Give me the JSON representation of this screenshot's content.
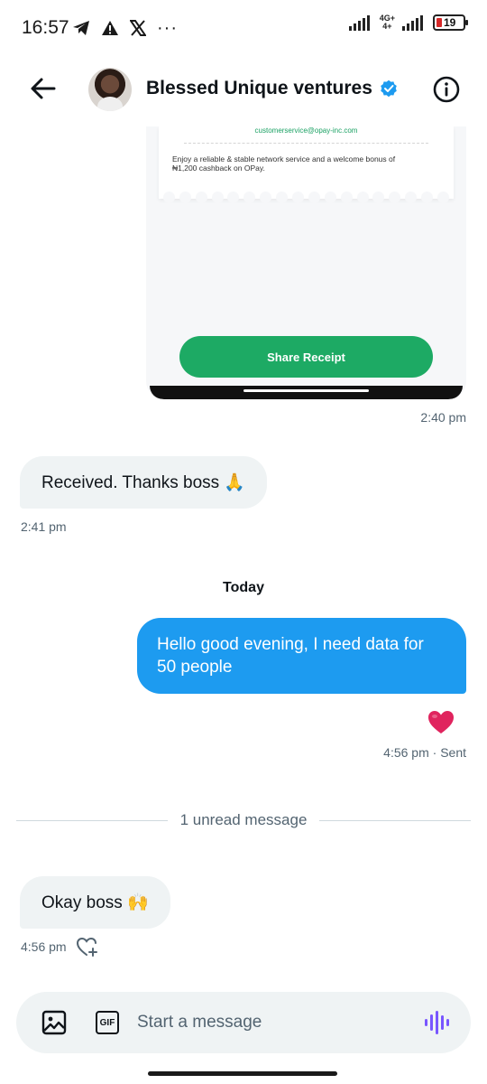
{
  "status_bar": {
    "time": "16:57",
    "network_label_top": "4G+",
    "network_label_bottom": "4+",
    "battery": "19",
    "more": "···"
  },
  "header": {
    "contact_name": "Blessed Unique ventures"
  },
  "receipt": {
    "email": "customerservice@opay-inc.com",
    "promo": "Enjoy a reliable & stable network service and a welcome bonus of ₦1,200 cashback on OPay.",
    "share_button": "Share Receipt"
  },
  "messages": [
    {
      "direction": "out",
      "kind": "image",
      "time": "2:40 pm"
    },
    {
      "direction": "in",
      "text": "Received.  Thanks boss 🙏",
      "time": "2:41 pm"
    },
    {
      "direction": "out",
      "text": "Hello good evening, I need data for 50 people",
      "reaction": "❤️",
      "time": "4:56 pm · Sent"
    },
    {
      "direction": "in",
      "text": "Okay boss 🙌",
      "time": "4:56 pm"
    }
  ],
  "separators": {
    "day": "Today",
    "unread": "1 unread message"
  },
  "composer": {
    "placeholder": "Start a message",
    "gif_label": "GIF"
  },
  "colors": {
    "accent_blue": "#1d9bf0",
    "incoming_bubble": "#eff3f4",
    "share_green": "#1daa64",
    "heart_red": "#e0245e",
    "voice_purple": "#7856ff"
  }
}
